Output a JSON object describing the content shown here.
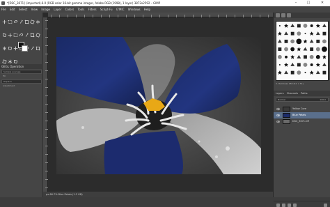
{
  "window": {
    "title": "*[DSC_3671] (imported)-6.0 (RGB color 16-bit gamma integer, Adobe RGB (1998), 1 layer) 3872x2592 – GIMP",
    "controls": [
      "–",
      "□",
      "✕"
    ]
  },
  "menu": {
    "items": [
      "File",
      "Edit",
      "Select",
      "View",
      "Image",
      "Layer",
      "Colors",
      "Tools",
      "Filters",
      "Script-Fu",
      "G'MIC",
      "Windows",
      "Help"
    ]
  },
  "toolbox": {
    "tool_icons": [
      "move-icon",
      "rect-select-icon",
      "lasso-icon",
      "fuzzy-select-icon",
      "crop-icon",
      "transform-icon",
      "flip-icon",
      "cage-icon",
      "warp-icon",
      "text-icon",
      "paint-bucket-icon",
      "gradient-icon",
      "pencil-icon",
      "paintbrush-icon",
      "eraser-icon",
      "airbrush-icon",
      "ink-icon",
      "clone-icon",
      "heal-icon",
      "smudge-icon",
      "dodge-icon",
      "measure-icon",
      "zoom-icon",
      "color-picker-icon"
    ],
    "fg_color": "#111111",
    "bg_color": "#ffffff",
    "options_title": "GEGL Operation",
    "options_rows": [
      "Sample average",
      "Fill",
      "Replace",
      "Adjustment"
    ]
  },
  "canvas": {
    "status_text": "px  66.7%  Blue Petals (1.2 GB)"
  },
  "brushes": {
    "panel_label": "Brushes",
    "name": "2. Hardness 050 (51 × 51)"
  },
  "layers": {
    "tabs": [
      "Layers",
      "Channels",
      "Paths"
    ],
    "mode": "Normal",
    "opacity": "100.0",
    "items": [
      {
        "name": "Yellow Core",
        "thumb": "#3a3a3a"
      },
      {
        "name": "Blue Petals",
        "thumb": "#1c2c6a"
      },
      {
        "name": "DSC_3671.tiff",
        "thumb": "#6a6a6a"
      }
    ]
  }
}
